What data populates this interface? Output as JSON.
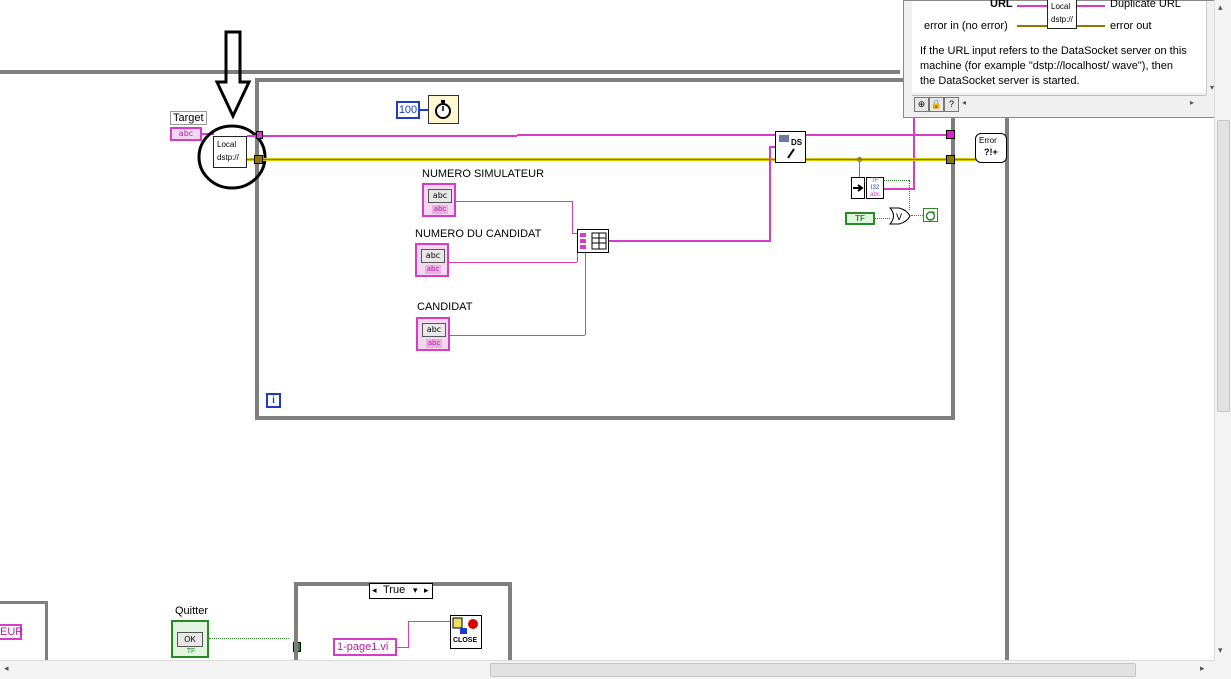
{
  "diagram": {
    "target_label": "Target",
    "target_const": "abc",
    "local_node": {
      "line1": "Local",
      "line2": "dstp://"
    },
    "wait_value": "100",
    "numero_simulateur_label": "NUMERO SIMULATEUR",
    "numero_candidat_label": "NUMERO DU CANDIDAT",
    "candidat_label": "CANDIDAT",
    "ctl_inner": "abc",
    "ctl_sub": "abc",
    "iteration_label": "i",
    "ds_write_label": "DS",
    "error_label": "Error",
    "tf_const": "TF",
    "or_label": "V",
    "quitter_label": "Quitter",
    "quitter_ok": "OK",
    "quitter_tf": "TF",
    "case_selector": "True",
    "page_const": "1-page1.vi",
    "close_label": "CLOSE",
    "partial_left_text": "EUR"
  },
  "help_window": {
    "url_label": "URL",
    "duplicate_label": "Duplicate URL",
    "error_in_label": "error in (no error)",
    "error_out_label": "error out",
    "icon_line1": "Local",
    "icon_line2": "dstp://",
    "description": "If the URL input refers to the DataSocket server on this machine (for example \"dstp://localhost/ wave\"), then the DataSocket server is started."
  },
  "colors": {
    "string_wire": "#d63cc8",
    "error_wire": "#8c7a00",
    "boolean_wire": "#2a8a2a",
    "numeric": "#1a3cc8",
    "frame": "#7f7f7f"
  }
}
